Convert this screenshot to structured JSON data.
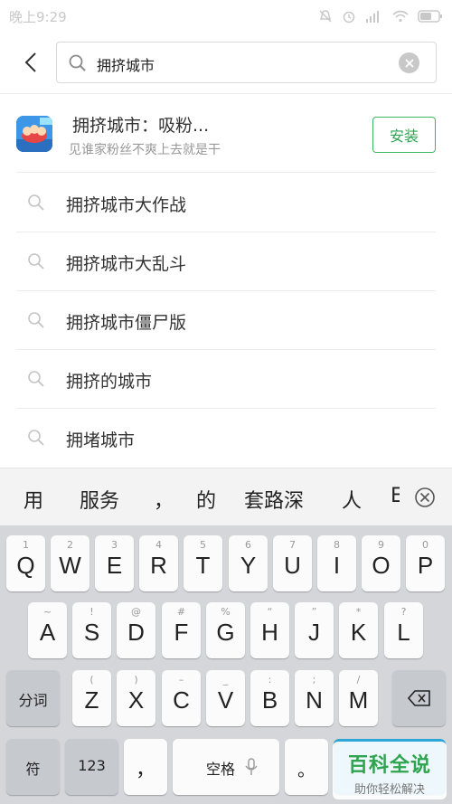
{
  "status_bar": {
    "time": "晚上9:29"
  },
  "search": {
    "query": "拥挤城市"
  },
  "app_result": {
    "name": "拥挤城市：吸粉...",
    "description": "见谁家粉丝不爽上去就是干",
    "install_label": "安装"
  },
  "suggestions": [
    "拥挤城市大作战",
    "拥挤城市大乱斗",
    "拥挤城市僵尸版",
    "拥挤的城市",
    "拥堵城市"
  ],
  "candidates": [
    "用",
    "服务",
    "，",
    "的",
    "套路深",
    "人",
    "E"
  ],
  "keyboard": {
    "row1": [
      {
        "hint": "1",
        "key": "Q"
      },
      {
        "hint": "2",
        "key": "W"
      },
      {
        "hint": "3",
        "key": "E"
      },
      {
        "hint": "4",
        "key": "R"
      },
      {
        "hint": "5",
        "key": "T"
      },
      {
        "hint": "6",
        "key": "Y"
      },
      {
        "hint": "7",
        "key": "U"
      },
      {
        "hint": "8",
        "key": "I"
      },
      {
        "hint": "9",
        "key": "O"
      },
      {
        "hint": "0",
        "key": "P"
      }
    ],
    "row2": [
      {
        "hint": "~",
        "key": "A"
      },
      {
        "hint": "!",
        "key": "S"
      },
      {
        "hint": "@",
        "key": "D"
      },
      {
        "hint": "#",
        "key": "F"
      },
      {
        "hint": "%",
        "key": "G"
      },
      {
        "hint": "“",
        "key": "H"
      },
      {
        "hint": "”",
        "key": "J"
      },
      {
        "hint": "*",
        "key": "K"
      },
      {
        "hint": "?",
        "key": "L"
      }
    ],
    "row3": [
      {
        "hint": "(",
        "key": "Z"
      },
      {
        "hint": ")",
        "key": "X"
      },
      {
        "hint": "–",
        "key": "C"
      },
      {
        "hint": "_",
        "key": "V"
      },
      {
        "hint": ":",
        "key": "B"
      },
      {
        "hint": ";",
        "key": "N"
      },
      {
        "hint": "/",
        "key": "M"
      }
    ],
    "fenci_label": "分词",
    "symbol_label": "符",
    "num_label": "123",
    "comma_label": "，",
    "space_label": "空格",
    "period_label": "。"
  },
  "watermark": {
    "title": "百科全说",
    "subtitle": "助你轻松解决"
  }
}
